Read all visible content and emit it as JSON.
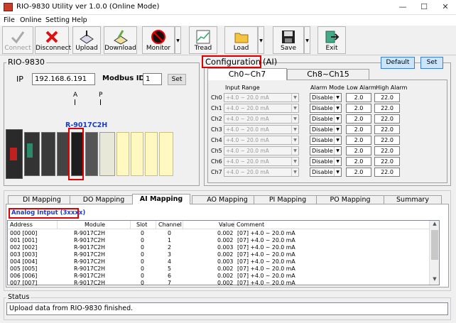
{
  "window": {
    "title": "RIO-9830 Utility  ver 1.0.0 (Online Mode)",
    "min": "—",
    "max": "☐",
    "close": "✕"
  },
  "menu": [
    "File",
    "Online",
    "Setting",
    "Help"
  ],
  "toolbar": {
    "connect": "Connect",
    "disconnect": "Disconnect",
    "upload": "Upload",
    "download": "Download",
    "monitor": "Monitor",
    "tread": "Tread",
    "load": "Load",
    "save": "Save",
    "exit": "Exit"
  },
  "device": {
    "name": "RIO-9830",
    "ip_label": "IP",
    "ip_value": "192.168.6.191",
    "modbus_label": "Modbus ID",
    "modbus_value": "1",
    "set_label": "Set",
    "slot_a": "A",
    "slot_p": "P",
    "module_label": "R-9017C2H"
  },
  "config": {
    "title": "Configuration",
    "title_suffix": "(AI)",
    "default_label": "Default",
    "set_label": "Set",
    "tab1": "Ch0~Ch7",
    "tab2": "Ch8~Ch15",
    "col_input": "Input Range",
    "col_alarm": "Alarm Mode",
    "col_low": "Low Alarm",
    "col_high": "High Alarm",
    "channels": [
      {
        "ch": "Ch0",
        "range": "+4.0 ~ 20.0 mA",
        "alarm": "Disable",
        "low": "2.0",
        "high": "22.0"
      },
      {
        "ch": "Ch1",
        "range": "+4.0 ~ 20.0 mA",
        "alarm": "Disable",
        "low": "2.0",
        "high": "22.0"
      },
      {
        "ch": "Ch2",
        "range": "+4.0 ~ 20.0 mA",
        "alarm": "Disable",
        "low": "2.0",
        "high": "22.0"
      },
      {
        "ch": "Ch3",
        "range": "+4.0 ~ 20.0 mA",
        "alarm": "Disable",
        "low": "2.0",
        "high": "22.0"
      },
      {
        "ch": "Ch4",
        "range": "+4.0 ~ 20.0 mA",
        "alarm": "Disable",
        "low": "2.0",
        "high": "22.0"
      },
      {
        "ch": "Ch5",
        "range": "+4.0 ~ 20.0 mA",
        "alarm": "Disable",
        "low": "2.0",
        "high": "22.0"
      },
      {
        "ch": "Ch6",
        "range": "+4.0 ~ 20.0 mA",
        "alarm": "Disable",
        "low": "2.0",
        "high": "22.0"
      },
      {
        "ch": "Ch7",
        "range": "+4.0 ~ 20.0 mA",
        "alarm": "Disable",
        "low": "2.0",
        "high": "22.0"
      }
    ]
  },
  "mapping": {
    "tabs": [
      "DI Mapping",
      "DO Mapping",
      "AI Mapping",
      "AO Mapping",
      "PI Mapping",
      "PO Mapping",
      "Summary"
    ],
    "section": "Analog Intput   (3xxxx)",
    "headers": [
      "Address",
      "Module",
      "Slot",
      "Channel",
      "Value",
      "Comment"
    ],
    "rows": [
      [
        "000 [000]",
        "R-9017C2H",
        "0",
        "0",
        "0.002",
        "[07] +4.0 ~ 20.0 mA"
      ],
      [
        "001 [001]",
        "R-9017C2H",
        "0",
        "1",
        "0.002",
        "[07] +4.0 ~ 20.0 mA"
      ],
      [
        "002 [002]",
        "R-9017C2H",
        "0",
        "2",
        "0.003",
        "[07] +4.0 ~ 20.0 mA"
      ],
      [
        "003 [003]",
        "R-9017C2H",
        "0",
        "3",
        "0.002",
        "[07] +4.0 ~ 20.0 mA"
      ],
      [
        "004 [004]",
        "R-9017C2H",
        "0",
        "4",
        "0.003",
        "[07] +4.0 ~ 20.0 mA"
      ],
      [
        "005 [005]",
        "R-9017C2H",
        "0",
        "5",
        "0.002",
        "[07] +4.0 ~ 20.0 mA"
      ],
      [
        "006 [006]",
        "R-9017C2H",
        "0",
        "6",
        "0.002",
        "[07] +4.0 ~ 20.0 mA"
      ],
      [
        "007 [007]",
        "R-9017C2H",
        "0",
        "7",
        "0.002",
        "[07] +4.0 ~ 20.0 mA"
      ]
    ]
  },
  "status": {
    "label": "Status",
    "message": "Upload data from RIO-9830 finished."
  },
  "colors": {
    "highlight": "#e00000",
    "link_blue": "#1a3ccc",
    "module_yellow": "#fff8c0"
  }
}
